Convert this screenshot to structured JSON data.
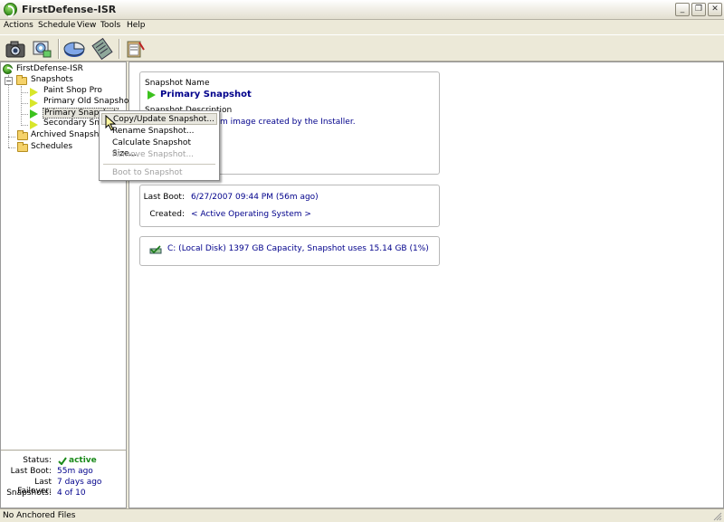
{
  "window": {
    "title": "FirstDefense-ISR"
  },
  "menu": [
    "Actions",
    "Schedule",
    "View",
    "Tools",
    "Help"
  ],
  "toolbar": {
    "buttons": [
      "camera-icon",
      "snapshot-settings-icon",
      "pie-chart-icon",
      "archive-icon",
      "clipboard-icon"
    ]
  },
  "tree": {
    "root": "FirstDefense-ISR",
    "snapshots_label": "Snapshots",
    "snapshots": [
      "Paint Shop Pro",
      "Primary Old Snapshot",
      "Primary Snapshot",
      "Secondary Snap"
    ],
    "archived_label": "Archived Snapshots",
    "schedules_label": "Schedules"
  },
  "status": {
    "status_label": "Status:",
    "status_value": "active",
    "last_boot_label": "Last Boot:",
    "last_boot_value": "55m ago",
    "last_failover_label": "Last Failover:",
    "last_failover_value": "7 days ago",
    "snapshots_label": "Snapshots:",
    "snapshots_value": "4 of 10"
  },
  "details": {
    "name_label": "Snapshot Name",
    "name_value": "Primary Snapshot",
    "description_label": "Snapshot Description",
    "description_value": "m image created by the Installer.",
    "last_boot_label": "Last Boot:",
    "last_boot_value": "6/27/2007 09:44 PM (56m ago)",
    "created_label": "Created:",
    "created_value": "< Active Operating System >",
    "disk_text": "C: (Local Disk) 1397 GB Capacity, Snapshot uses 15.14 GB (1%)"
  },
  "context_menu": {
    "items": [
      "Copy/Update Snapshot...",
      "Rename Snapshot...",
      "Calculate Snapshot Size...",
      "Remove Snapshot..."
    ],
    "disabled_item": "Boot to Snapshot"
  },
  "statusbar": {
    "text": "No Anchored Files"
  }
}
